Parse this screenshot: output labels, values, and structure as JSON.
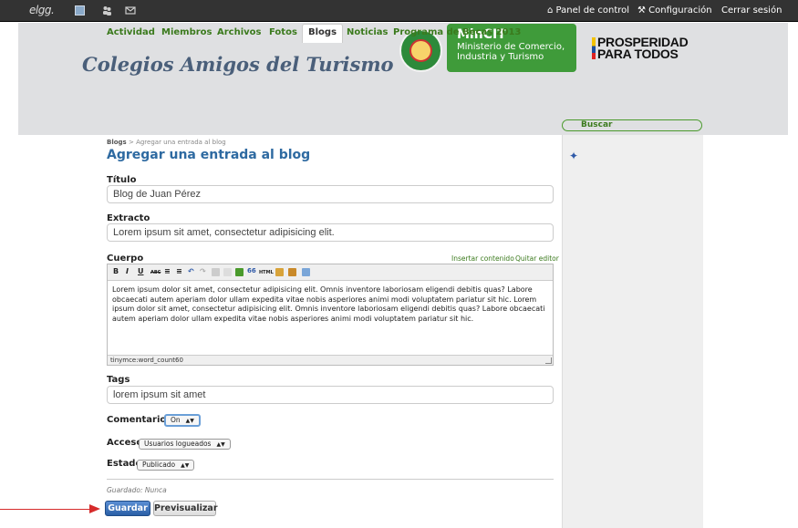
{
  "topbar": {
    "logo": "elgg.",
    "panel": "Panel de control",
    "config": "Configuración",
    "logout": "Cerrar sesión"
  },
  "header": {
    "site_title": "Colegios Amigos del Turismo",
    "mincit_title": "MinCIT",
    "mincit_line1": "Ministerio de Comercio,",
    "mincit_line2": "Industria y Turismo",
    "prosp_line1": "PROSPERIDAD",
    "prosp_line2": "PARA TODOS"
  },
  "tabs": [
    {
      "label": "Actividad"
    },
    {
      "label": "Miembros"
    },
    {
      "label": "Archivos"
    },
    {
      "label": "Fotos"
    },
    {
      "label": "Blogs"
    },
    {
      "label": "Noticias"
    },
    {
      "label": "Programa de Becas 2013"
    }
  ],
  "search": {
    "label": "Buscar"
  },
  "breadcrumb": {
    "root": "Blogs",
    "sep": ">",
    "current": "Agregar una entrada al blog"
  },
  "page_title": "Agregar una entrada al blog",
  "form": {
    "title_label": "Título",
    "title_value": "Blog de Juan Pérez",
    "excerpt_label": "Extracto",
    "excerpt_value": "Lorem ipsum sit amet, consectetur adipisicing elit.",
    "body_label": "Cuerpo",
    "insert_content": "Insertar contenido",
    "remove_editor": "Quitar editor",
    "body_text": "Lorem ipsum dolor sit amet, consectetur adipisicing elit. Omnis inventore laboriosam eligendi debitis quas? Labore obcaecati autem aperiam dolor ullam expedita vitae nobis asperiores animi modi voluptatem pariatur sit hic. Lorem ipsum dolor sit amet, consectetur adipisicing elit. Omnis inventore laboriosam eligendi debitis quas? Labore obcaecati autem aperiam dolor ullam expedita vitae nobis asperiores animi modi voluptatem pariatur sit hic.",
    "word_count": "tinymce:word_count60",
    "tags_label": "Tags",
    "tags_value": "lorem ipsum sit amet",
    "comments_label": "Comentarios",
    "comments_value": "On",
    "access_label": "Acceso",
    "access_value": "Usuarios logueados",
    "status_label": "Estado",
    "status_value": "Publicado",
    "saved": "Guardado: Nunca",
    "save_button": "Guardar",
    "preview_button": "Previsualizar"
  },
  "toolbar": {
    "bold": "B",
    "italic": "I",
    "underline": "U",
    "abc": "ABC",
    "quote": "66",
    "html": "HTML"
  },
  "colors": {
    "accent_blue": "#2e6aa1",
    "tab_green": "#3b7a1d",
    "arrow_red": "#d62b2b"
  }
}
